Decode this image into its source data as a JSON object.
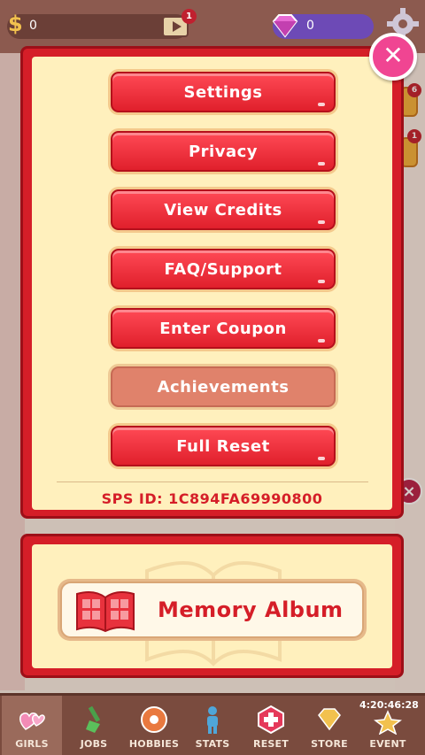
{
  "topbar": {
    "money_value": "0",
    "video_badge": "1",
    "gems_value": "0"
  },
  "side": {
    "badge_top": "6",
    "badge_second": "1"
  },
  "settings_modal": {
    "buttons": [
      {
        "label": "Settings"
      },
      {
        "label": "Privacy"
      },
      {
        "label": "View Credits"
      },
      {
        "label": "FAQ/Support"
      },
      {
        "label": "Enter Coupon"
      },
      {
        "label": "Achievements"
      },
      {
        "label": "Full Reset"
      }
    ],
    "sps_id": "SPS ID: 1C894FA69990800",
    "close_label": "x"
  },
  "album": {
    "label": "Memory Album"
  },
  "nav": {
    "items": [
      {
        "label": "GIRLS",
        "icon": "hearts-icon"
      },
      {
        "label": "JOBS",
        "icon": "shovel-icon"
      },
      {
        "label": "HOBBIES",
        "icon": "ball-icon"
      },
      {
        "label": "STATS",
        "icon": "person-icon"
      },
      {
        "label": "RESET",
        "icon": "reset-icon"
      },
      {
        "label": "STORE",
        "icon": "gem-store-icon"
      },
      {
        "label": "EVENT",
        "icon": "star-icon"
      }
    ],
    "timer": "4:20:46:28"
  },
  "colors": {
    "modal_red": "#d51e28",
    "panel_cream": "#fff0bd",
    "close_pink": "#f04592"
  }
}
